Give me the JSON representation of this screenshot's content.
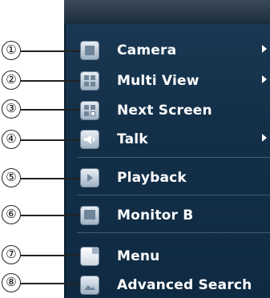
{
  "menu": {
    "items": [
      {
        "label": "Camera",
        "has_submenu": true,
        "icon": "camera-icon",
        "callout": "①"
      },
      {
        "label": "Multi View",
        "has_submenu": true,
        "icon": "multi-view-icon",
        "callout": "②"
      },
      {
        "label": "Next Screen",
        "has_submenu": false,
        "icon": "next-screen-icon",
        "callout": "③"
      },
      {
        "label": "Talk",
        "has_submenu": true,
        "icon": "speaker-icon",
        "callout": "④"
      },
      {
        "label": "Playback",
        "has_submenu": false,
        "icon": "play-icon",
        "callout": "⑤"
      },
      {
        "label": "Monitor B",
        "has_submenu": false,
        "icon": "monitor-icon",
        "callout": "⑥"
      },
      {
        "label": "Menu",
        "has_submenu": false,
        "icon": "document-icon",
        "callout": "⑦"
      },
      {
        "label": "Advanced Search",
        "has_submenu": false,
        "icon": "search-image-icon",
        "callout": "⑧"
      }
    ]
  },
  "colors": {
    "panel_bg": "#143049",
    "text": "#ffffff",
    "divider": "#3f5a73"
  }
}
